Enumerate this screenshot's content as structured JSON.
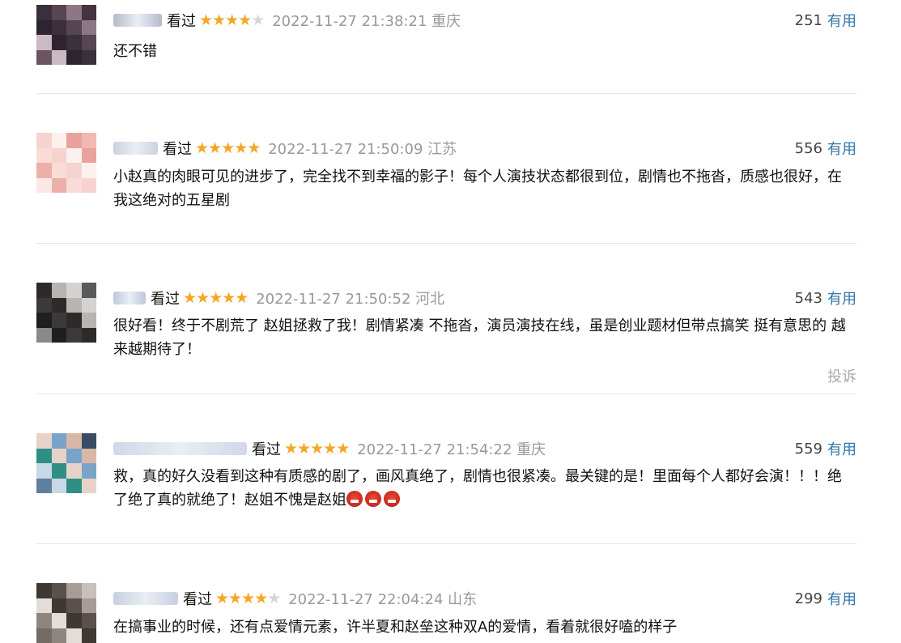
{
  "status_label": "看过",
  "useful_label": "有用",
  "report_label": "投诉",
  "comments": [
    {
      "username_hidden": "高晨阳",
      "stars": 4,
      "time": "2022-11-27 21:38:21",
      "location": "重庆",
      "votes": "251",
      "text": "还不错",
      "emoji_count": 0,
      "has_report": false
    },
    {
      "username_hidden": "用户",
      "stars": 5,
      "time": "2022-11-27 21:50:09",
      "location": "江苏",
      "votes": "556",
      "text": "小赵真的肉眼可见的进步了，完全找不到幸福的影子！每个人演技状态都很到位，剧情也不拖沓，质感也很好，在我这绝对的五星剧",
      "emoji_count": 0,
      "has_report": false
    },
    {
      "username_hidden": "可泥",
      "stars": 5,
      "time": "2022-11-27 21:50:52",
      "location": "河北",
      "votes": "543",
      "text": "很好看！终于不剧荒了 赵姐拯救了我！剧情紧凑 不拖沓，演员演技在线，虽是创业题材但带点搞笑 挺有意思的 越来越期待了！",
      "emoji_count": 0,
      "has_report": true
    },
    {
      "username_hidden": "用户名",
      "stars": 5,
      "time": "2022-11-27 21:54:22",
      "location": "重庆",
      "votes": "559",
      "text": "救，真的好久没看到这种有质感的剧了，画风真绝了，剧情也很紧凑。最关键的是！里面每个人都好会演！！！绝了绝了真的就绝了！赵姐不愧是赵姐",
      "emoji_count": 3,
      "has_report": false
    },
    {
      "username_hidden": "用户",
      "stars": 4,
      "time": "2022-11-27 22:04:24",
      "location": "山东",
      "votes": "299",
      "text": "在搞事业的时候，还有点爱情元素，许半夏和赵垒这种双A的爱情，看着就很好嗑的样子",
      "emoji_count": 0,
      "has_report": false
    }
  ]
}
